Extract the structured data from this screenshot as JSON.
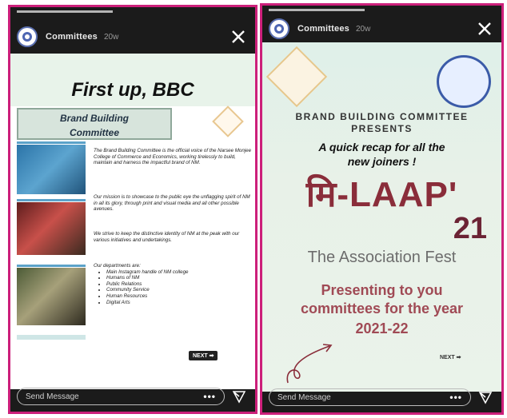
{
  "left_story": {
    "account": "Committees",
    "time": "20w",
    "title": "First up, BBC",
    "banner_line1": "Brand Building",
    "banner_line2": "Committee",
    "para1": "The Brand Building Committee is the official voice of the Narsee Monjee College of Commerce and Economics, working tirelessly to build, maintain and harness the impactful brand of NM.",
    "para2": "Our mission is to showcase to the public eye the unflagging spirit of NM in all its glory, through print and visual media and all other possible avenues.",
    "para3": "We strive to keep the distinctive identity of NM at the peak with our various initiatives and undertakings.",
    "para4_intro": "Our departments are:",
    "departments": [
      "Main Instagram handle of NM college",
      "Humans of NM",
      "Public Relations",
      "Community Service",
      "Human Resources",
      "Digital Arts"
    ],
    "next_label": "NEXT ➡",
    "message_placeholder": "Send Message",
    "more_label": "•••"
  },
  "right_story": {
    "account": "Committees",
    "time": "20w",
    "line1": "BRAND BUILDING COMMITTEE",
    "line2": "PRESENTS",
    "line3": "A quick recap for all the",
    "line4": "new joiners !",
    "fest_name": "मि-LAAP'",
    "fest_year": "21",
    "fest_subtitle": "The Association Fest",
    "presenting1": "Presenting to you",
    "presenting2": "committees for the year",
    "presenting3": "2021-22",
    "next_label": "NEXT ➡",
    "message_placeholder": "Send Message",
    "more_label": "•••"
  },
  "colors": {
    "frame": "#cc1f7a",
    "fest_maroon": "#8a2d3a",
    "presenting": "#a04a55"
  },
  "icons": [
    "avatar-icon",
    "close-icon",
    "send-icon",
    "more-icon",
    "arrow-icon"
  ]
}
